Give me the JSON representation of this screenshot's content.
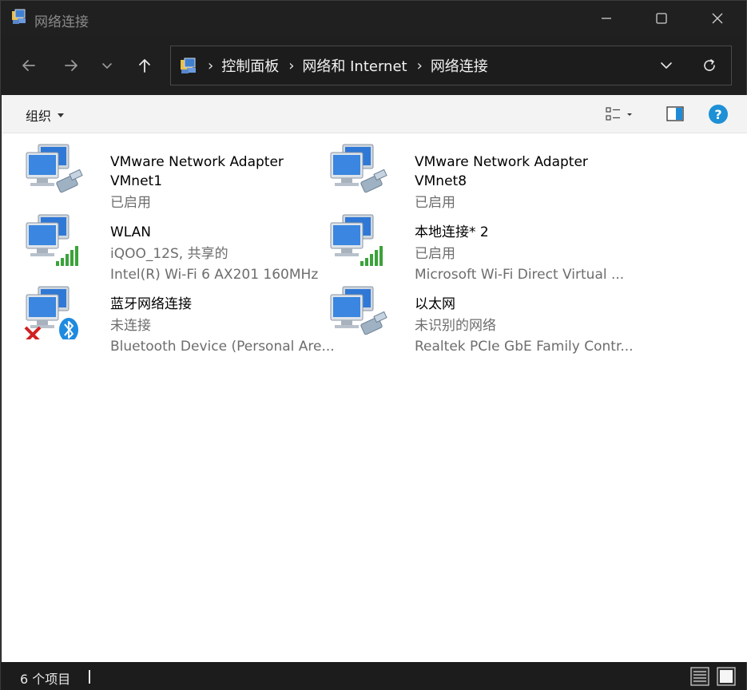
{
  "window": {
    "title": "网络连接"
  },
  "address": {
    "crumbs": [
      "控制面板",
      "网络和 Internet",
      "网络连接"
    ],
    "separator": "›"
  },
  "toolbar": {
    "organize_label": "组织"
  },
  "items": [
    {
      "name_lines": [
        "VMware Network Adapter",
        "VMnet1"
      ],
      "status": "已启用",
      "detail": "",
      "overlay": "cable"
    },
    {
      "name_lines": [
        "VMware Network Adapter",
        "VMnet8"
      ],
      "status": "已启用",
      "detail": "",
      "overlay": "cable"
    },
    {
      "name_lines": [
        "WLAN"
      ],
      "status": "iQOO_12S, 共享的",
      "detail": "Intel(R) Wi-Fi 6 AX201 160MHz",
      "overlay": "signal"
    },
    {
      "name_lines": [
        "本地连接* 2"
      ],
      "status": "已启用",
      "detail": "Microsoft Wi-Fi Direct Virtual ...",
      "overlay": "signal"
    },
    {
      "name_lines": [
        "蓝牙网络连接"
      ],
      "status": "未连接",
      "detail": "Bluetooth Device (Personal Are...",
      "overlay": "bluetooth"
    },
    {
      "name_lines": [
        "以太网"
      ],
      "status": "未识别的网络",
      "detail": "Realtek PCIe GbE Family Contr...",
      "overlay": "cable"
    }
  ],
  "statusbar": {
    "count_text": "6 个项目"
  },
  "colors": {
    "accent": "#0078d4",
    "help": "#1e90d6",
    "signal": "#3aa33a",
    "error": "#d22020"
  }
}
